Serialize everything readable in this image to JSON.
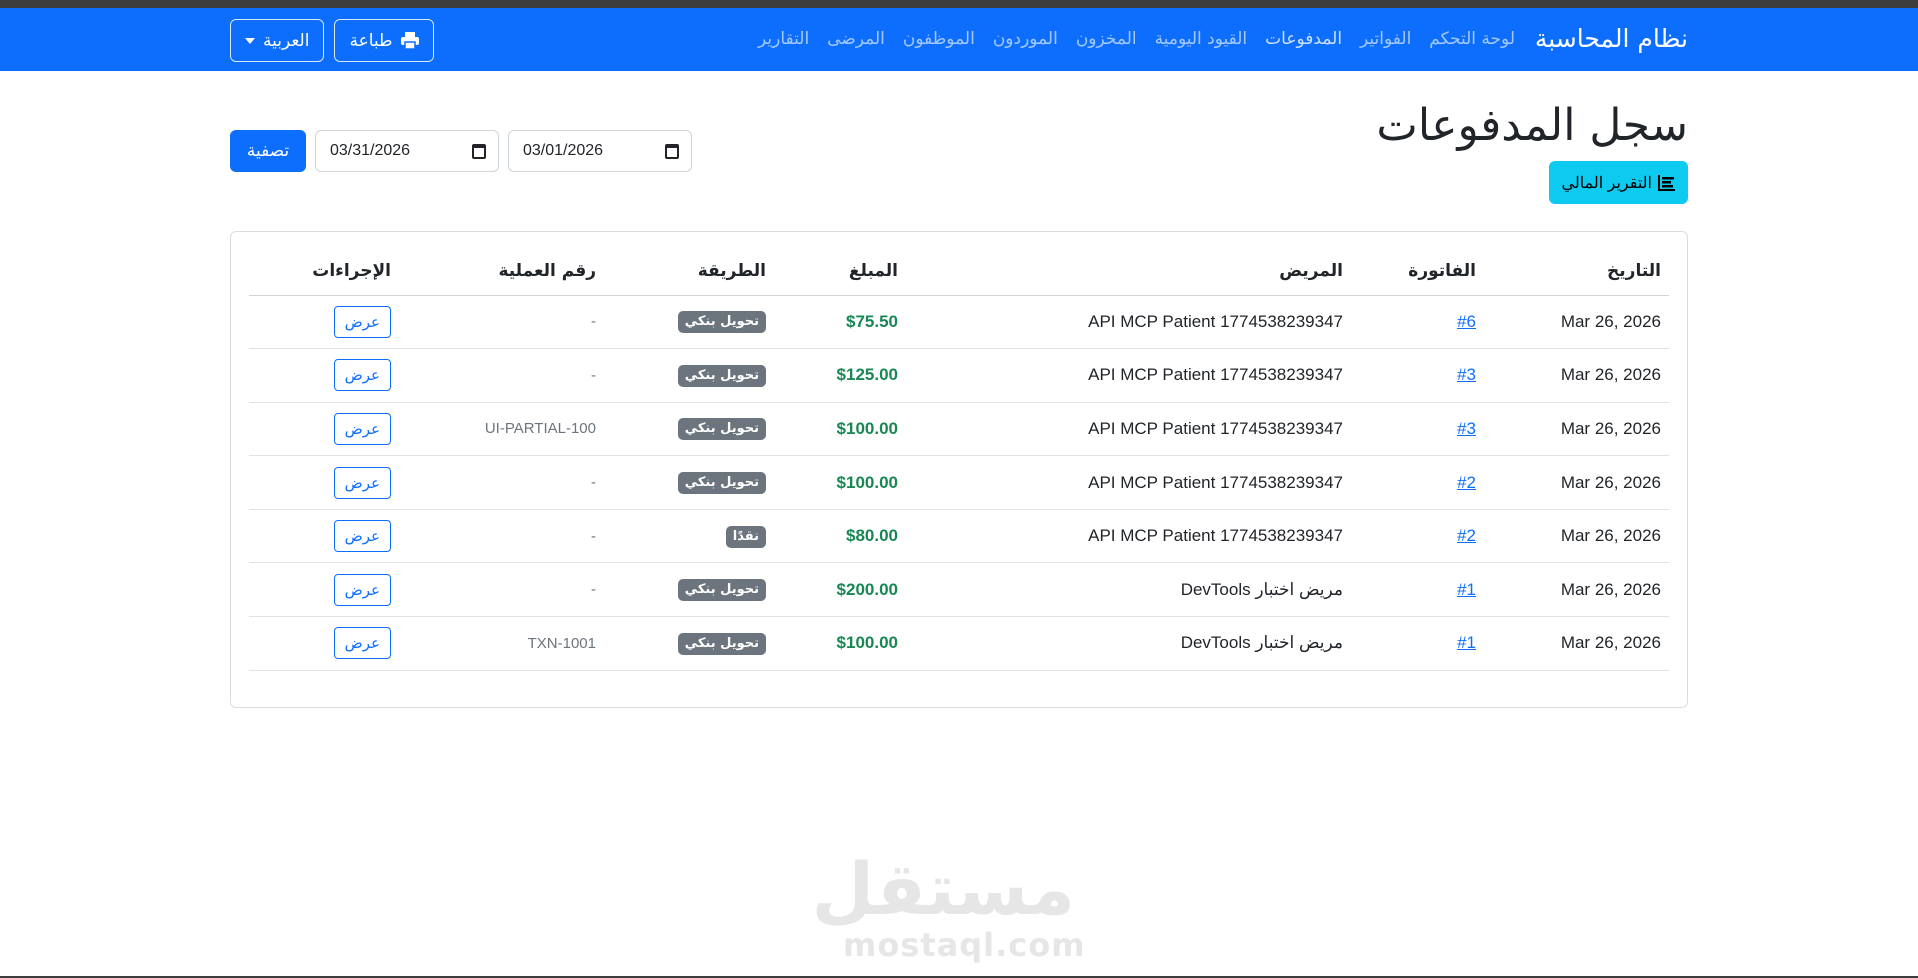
{
  "navbar": {
    "brand": "نظام المحاسبة",
    "links": [
      {
        "label": "لوحة التحكم"
      },
      {
        "label": "الفواتير"
      },
      {
        "label": "المدفوعات"
      },
      {
        "label": "القيود اليومية"
      },
      {
        "label": "المخزون"
      },
      {
        "label": "الموردون"
      },
      {
        "label": "الموظفون"
      },
      {
        "label": "المرضى"
      },
      {
        "label": "التقارير"
      }
    ],
    "print_label": "طباعة",
    "language_label": "العربية"
  },
  "page": {
    "title": "سجل المدفوعات",
    "report_label": "التقرير المالي"
  },
  "filters": {
    "from_date": "03/01/2026",
    "to_date": "03/31/2026",
    "filter_label": "تصفية"
  },
  "table": {
    "headers": {
      "date": "التاريخ",
      "invoice": "الفاتورة",
      "patient": "المريض",
      "amount": "المبلغ",
      "method": "الطريقة",
      "txn": "رقم العملية",
      "actions": "الإجراءات"
    },
    "view_label": "عرض",
    "rows": [
      {
        "date": "Mar 26, 2026",
        "invoice": "#6",
        "patient": "API MCP Patient 1774538239347",
        "amount": "$75.50",
        "method": "تحويل بنكي",
        "txn": "-"
      },
      {
        "date": "Mar 26, 2026",
        "invoice": "#3",
        "patient": "API MCP Patient 1774538239347",
        "amount": "$125.00",
        "method": "تحويل بنكي",
        "txn": "-"
      },
      {
        "date": "Mar 26, 2026",
        "invoice": "#3",
        "patient": "API MCP Patient 1774538239347",
        "amount": "$100.00",
        "method": "تحويل بنكي",
        "txn": "UI-PARTIAL-100"
      },
      {
        "date": "Mar 26, 2026",
        "invoice": "#2",
        "patient": "API MCP Patient 1774538239347",
        "amount": "$100.00",
        "method": "تحويل بنكي",
        "txn": "-"
      },
      {
        "date": "Mar 26, 2026",
        "invoice": "#2",
        "patient": "API MCP Patient 1774538239347",
        "amount": "$80.00",
        "method": "نقدًا",
        "txn": "-"
      },
      {
        "date": "Mar 26, 2026",
        "invoice": "#1",
        "patient": "مريض اختبار DevTools",
        "amount": "$200.00",
        "method": "تحويل بنكي",
        "txn": "-"
      },
      {
        "date": "Mar 26, 2026",
        "invoice": "#1",
        "patient": "مريض اختبار DevTools",
        "amount": "$100.00",
        "method": "تحويل بنكي",
        "txn": "TXN-1001"
      }
    ]
  },
  "watermark": {
    "logo_text": "مستقل",
    "domain": "mostaql.com"
  },
  "colors": {
    "primary": "#0d6efd",
    "info": "#0dcaf0",
    "success": "#198754",
    "secondary": "#6c757d"
  }
}
